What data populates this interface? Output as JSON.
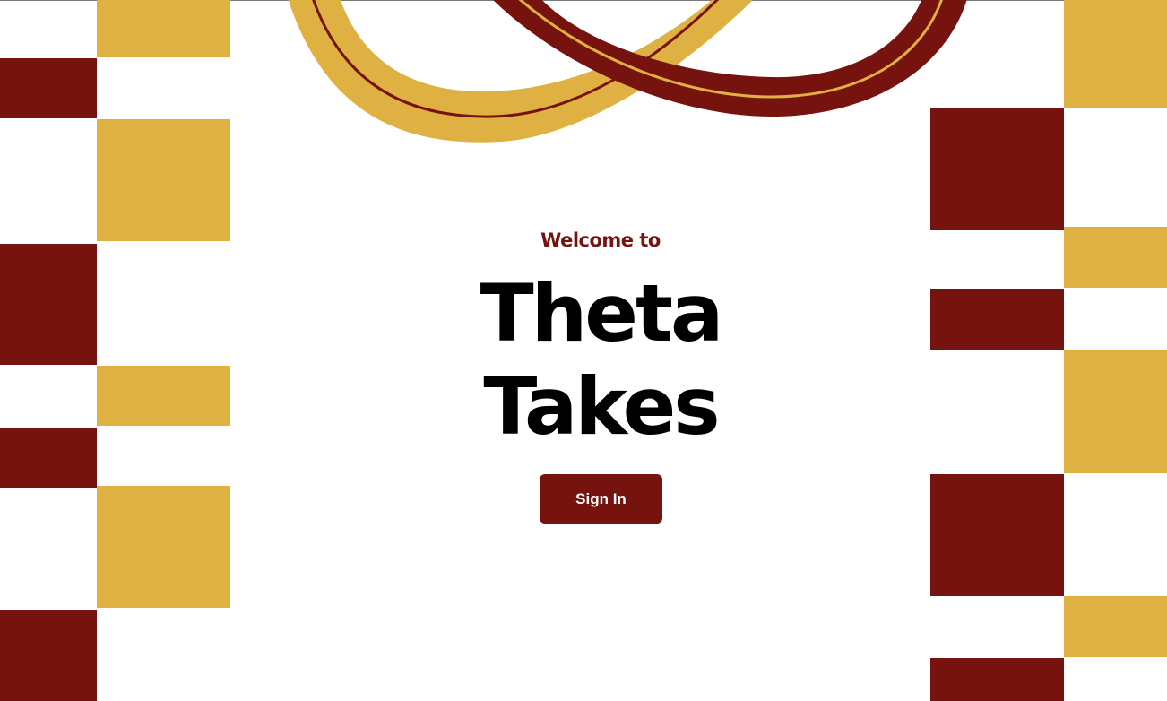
{
  "welcome_text": "Welcome to",
  "title_line_1": "Theta",
  "title_line_2": "Takes",
  "signin_label": "Sign In",
  "colors": {
    "maroon": "#76130e",
    "gold": "#deb142",
    "background": "#ffffff",
    "title": "#000000"
  }
}
